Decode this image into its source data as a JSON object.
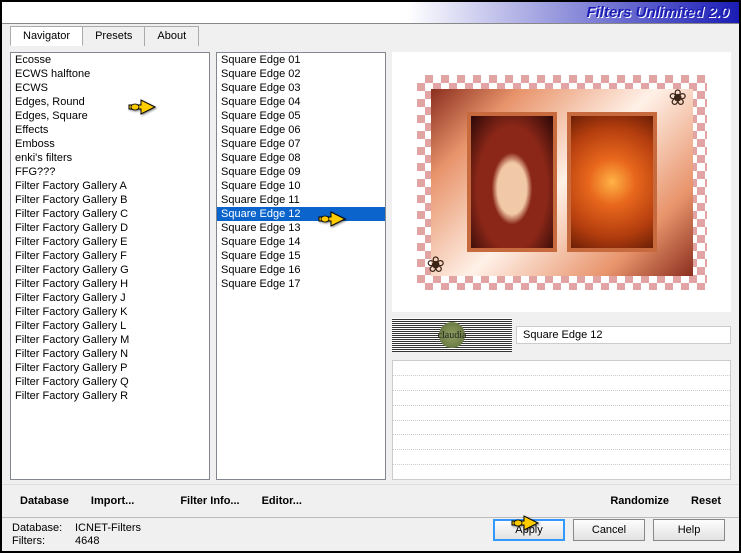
{
  "title": "Filters Unlimited 2.0",
  "tabs": [
    {
      "label": "Navigator",
      "active": true
    },
    {
      "label": "Presets",
      "active": false
    },
    {
      "label": "About",
      "active": false
    }
  ],
  "categories": [
    "Ecosse",
    "ECWS halftone",
    "ECWS",
    "Edges, Round",
    "Edges, Square",
    "Effects",
    "Emboss",
    "enki's filters",
    "FFG???",
    "Filter Factory Gallery A",
    "Filter Factory Gallery B",
    "Filter Factory Gallery C",
    "Filter Factory Gallery D",
    "Filter Factory Gallery E",
    "Filter Factory Gallery F",
    "Filter Factory Gallery G",
    "Filter Factory Gallery H",
    "Filter Factory Gallery J",
    "Filter Factory Gallery K",
    "Filter Factory Gallery L",
    "Filter Factory Gallery M",
    "Filter Factory Gallery N",
    "Filter Factory Gallery P",
    "Filter Factory Gallery Q",
    "Filter Factory Gallery R"
  ],
  "category_selected_index": 4,
  "filters": [
    "Square Edge 01",
    "Square Edge 02",
    "Square Edge 03",
    "Square Edge 04",
    "Square Edge 05",
    "Square Edge 06",
    "Square Edge 07",
    "Square Edge 08",
    "Square Edge 09",
    "Square Edge 10",
    "Square Edge 11",
    "Square Edge 12",
    "Square Edge 13",
    "Square Edge 14",
    "Square Edge 15",
    "Square Edge 16",
    "Square Edge 17"
  ],
  "filter_selected_index": 11,
  "selected_filter_name": "Square Edge 12",
  "watermark_text": "claudia",
  "buttons": {
    "database": "Database",
    "import": "Import...",
    "filter_info": "Filter Info...",
    "editor": "Editor...",
    "randomize": "Randomize",
    "reset": "Reset",
    "apply": "Apply",
    "cancel": "Cancel",
    "help": "Help"
  },
  "status": {
    "db_key": "Database:",
    "db_val": "ICNET-Filters",
    "filters_key": "Filters:",
    "filters_val": "4648"
  }
}
